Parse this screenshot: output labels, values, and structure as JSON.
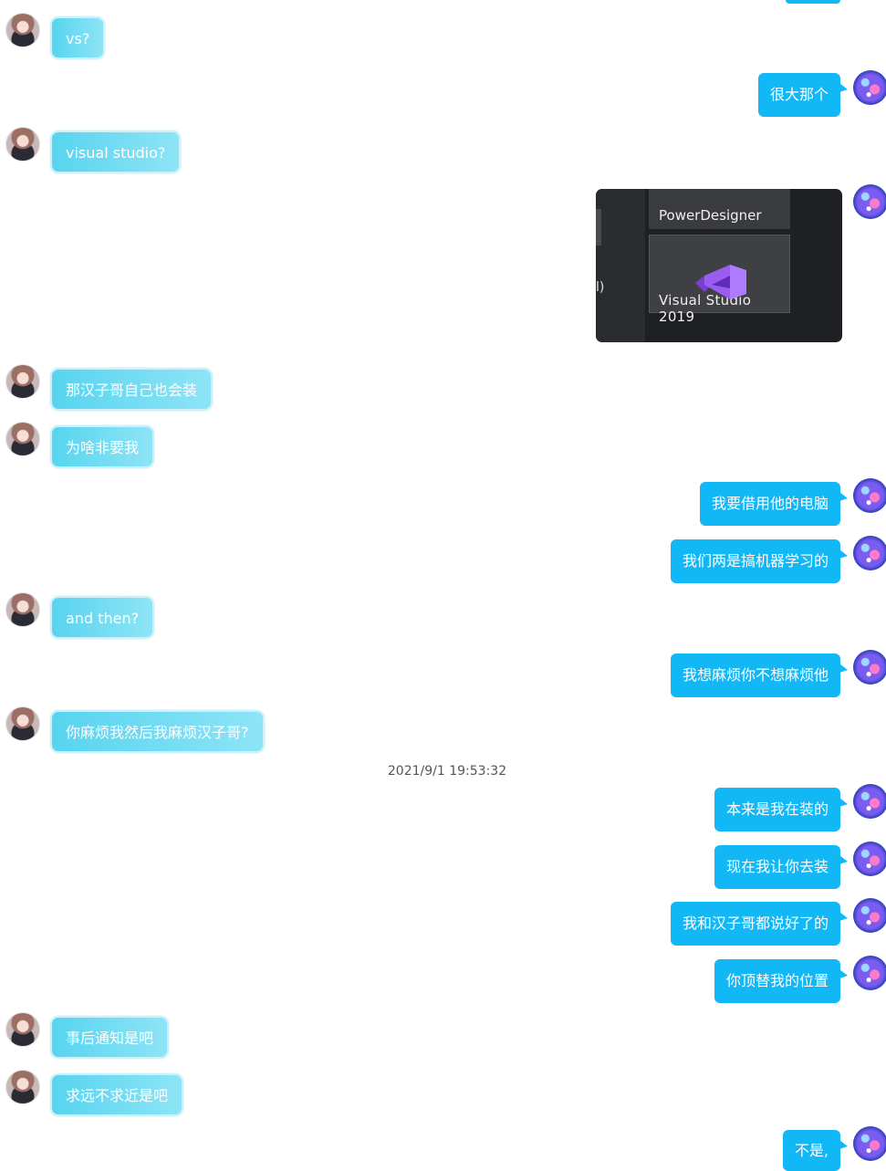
{
  "timestamp": "2021/9/1 19:53:32",
  "messages": [
    {
      "side": "left",
      "text": "vs?"
    },
    {
      "side": "right",
      "text": "很大那个"
    },
    {
      "side": "left",
      "text": "visual studio?"
    },
    {
      "side": "right",
      "type": "image"
    },
    {
      "side": "left",
      "text": "那汉子哥自己也会装"
    },
    {
      "side": "left",
      "text": "为啥非要我"
    },
    {
      "side": "right",
      "text": "我要借用他的电脑"
    },
    {
      "side": "right",
      "text": "我们两是搞机器学习的"
    },
    {
      "side": "left",
      "text": "and then?"
    },
    {
      "side": "right",
      "text": "我想麻烦你不想麻烦他"
    },
    {
      "side": "left",
      "text": "你麻烦我然后我麻烦汉子哥?"
    },
    {
      "side": "right",
      "text": "本来是我在装的"
    },
    {
      "side": "right",
      "text": "现在我让你去装"
    },
    {
      "side": "right",
      "text": "我和汉子哥都说好了的"
    },
    {
      "side": "right",
      "text": "你顶替我的位置"
    },
    {
      "side": "left",
      "text": "事后通知是吧"
    },
    {
      "side": "left",
      "text": "求远不求近是吧"
    },
    {
      "side": "right",
      "text": "不是,"
    }
  ],
  "screenshot": {
    "tile_top": "PowerDesigner",
    "tile_main": "Visual Studio 2019",
    "left_fragment": "l)",
    "logo_icon": "visual-studio-icon"
  }
}
